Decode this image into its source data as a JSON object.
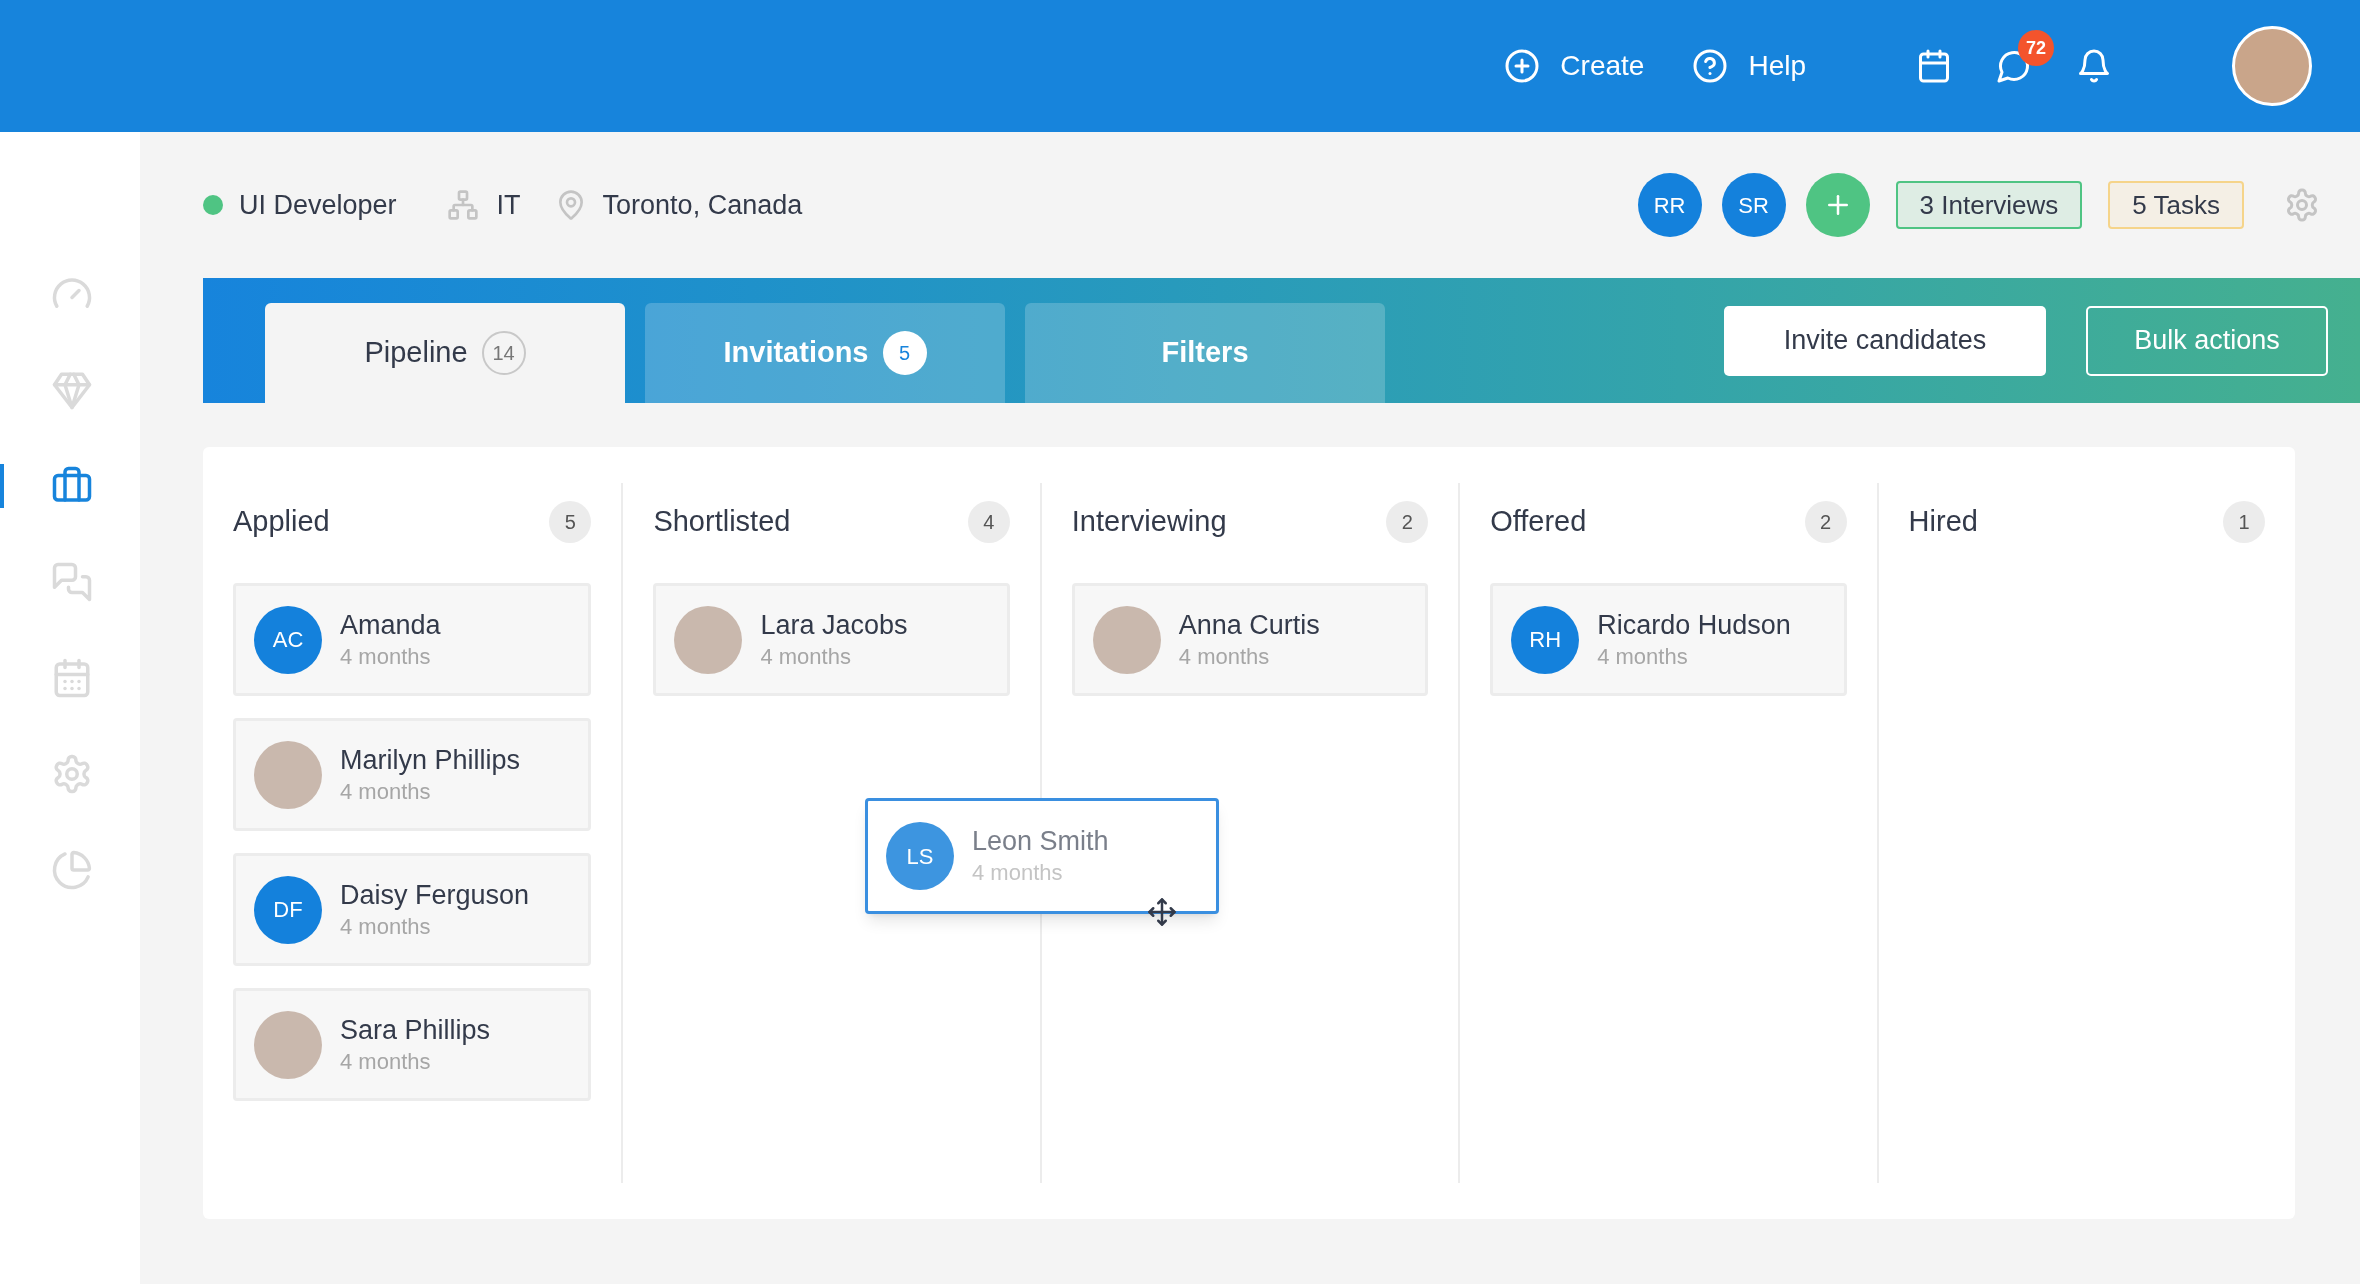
{
  "topbar": {
    "actions": [
      {
        "kind": "create",
        "label": "Create"
      },
      {
        "kind": "help",
        "label": "Help"
      }
    ],
    "icons": [
      {
        "kind": "calendar"
      },
      {
        "kind": "chat",
        "badge": "72"
      },
      {
        "kind": "bell"
      }
    ]
  },
  "sidebar": {
    "items": [
      {
        "kind": "dashboard",
        "selected": false
      },
      {
        "kind": "diamond",
        "selected": false
      },
      {
        "kind": "briefcase",
        "selected": true
      },
      {
        "kind": "chat",
        "selected": false
      },
      {
        "kind": "calendar",
        "selected": false
      },
      {
        "kind": "settings",
        "selected": false
      },
      {
        "kind": "chart",
        "selected": false
      }
    ]
  },
  "job": {
    "title": "UI Developer",
    "department": "IT",
    "location": "Toronto, Canada"
  },
  "team": [
    "RR",
    "SR"
  ],
  "summary": [
    {
      "label": "3 Interviews",
      "color": "#4fc483"
    },
    {
      "label": "5 Tasks",
      "color": "#f5d48a"
    }
  ],
  "tabs": [
    {
      "label": "Pipeline",
      "count": "14",
      "selected": true
    },
    {
      "label": "Invitations",
      "count": "5",
      "selected": false
    },
    {
      "label": "Filters",
      "selected": false
    }
  ],
  "buttons": [
    {
      "label": "Invite candidates",
      "kind": "solid"
    },
    {
      "label": "Bulk actions",
      "kind": "outline"
    }
  ],
  "columns": [
    {
      "title": "Applied",
      "count": "5",
      "cards": [
        {
          "kind": "initials",
          "initials": "AC",
          "name": "Amanda",
          "time": "4 months"
        },
        {
          "kind": "photo",
          "name": "Marilyn Phillips",
          "time": "4 months"
        },
        {
          "kind": "initials",
          "initials": "DF",
          "name": "Daisy Ferguson",
          "time": "4 months"
        },
        {
          "kind": "photo",
          "name": "Sara Phillips",
          "time": "4 months"
        }
      ]
    },
    {
      "title": "Shortlisted",
      "count": "4",
      "cards": [
        {
          "kind": "photo",
          "name": "Lara Jacobs",
          "time": "4 months"
        }
      ]
    },
    {
      "title": "Interviewing",
      "count": "2",
      "cards": [
        {
          "kind": "photo",
          "name": "Anna Curtis",
          "time": "4 months"
        }
      ]
    },
    {
      "title": "Offered",
      "count": "2",
      "cards": [
        {
          "kind": "initials",
          "initials": "RH",
          "name": "Ricardo Hudson",
          "time": "4 months"
        }
      ]
    },
    {
      "title": "Hired",
      "count": "1"
    }
  ],
  "dragging": {
    "initials": "LS",
    "name": "Leon Smith",
    "time": "4 months"
  }
}
